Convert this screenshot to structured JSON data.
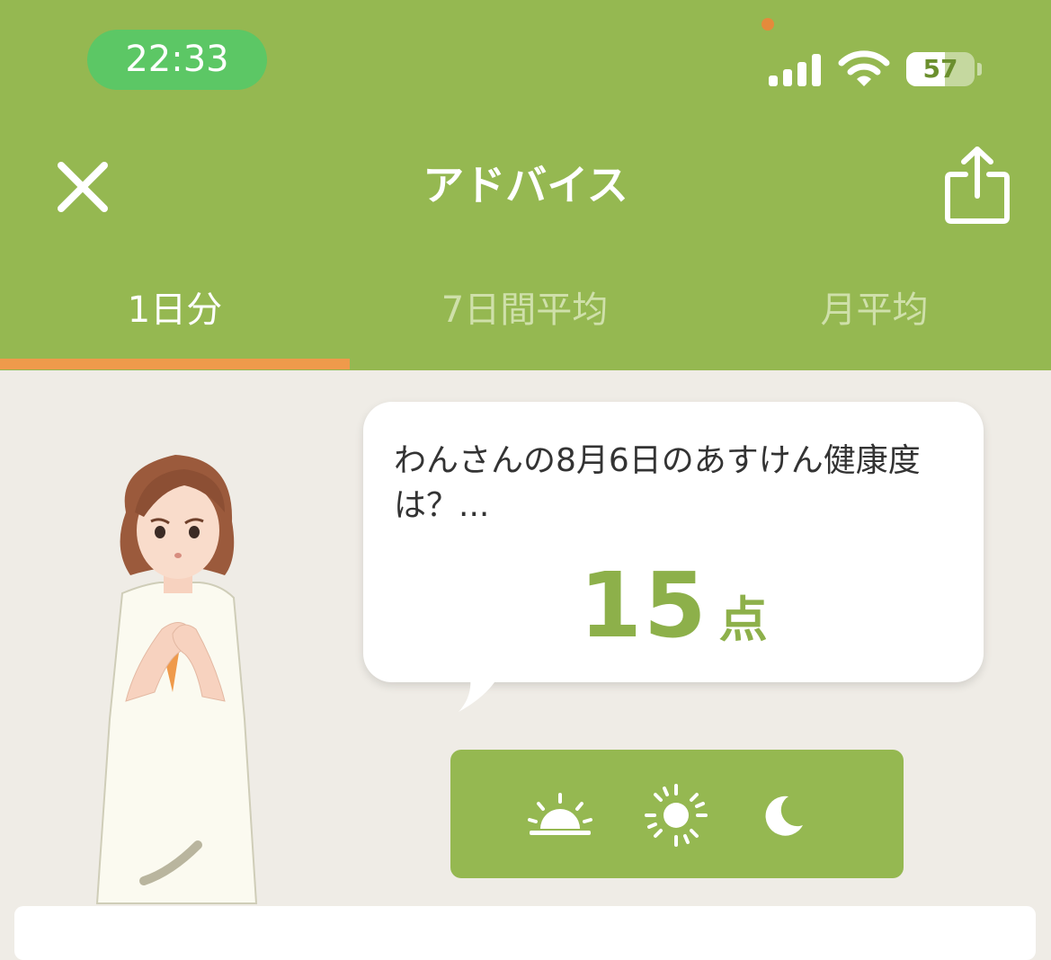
{
  "status_bar": {
    "time": "22:33",
    "battery_level": "57",
    "battery_fraction": 0.57,
    "icons": [
      "signal-icon",
      "wifi-icon",
      "battery-icon"
    ]
  },
  "header": {
    "title": "アドバイス",
    "close_icon": "close-icon",
    "share_icon": "share-icon"
  },
  "tabs": [
    {
      "label": "1日分",
      "active": true
    },
    {
      "label": "7日間平均",
      "active": false
    },
    {
      "label": "月平均",
      "active": false
    }
  ],
  "advice": {
    "message": "わんさんの8月6日のあすけん健康度は？...",
    "score": "15",
    "score_unit": "点"
  },
  "time_of_day": [
    {
      "icon": "sunrise-icon"
    },
    {
      "icon": "sun-icon"
    },
    {
      "icon": "moon-icon"
    }
  ],
  "colors": {
    "header_green": "#95b851",
    "active_indicator": "#ef9a4b",
    "score_green": "#8db04a",
    "background": "#efece6",
    "time_pill": "#5cc765"
  }
}
